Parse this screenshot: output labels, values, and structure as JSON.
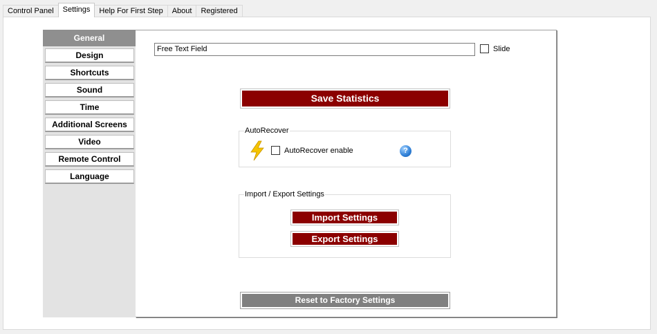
{
  "tabs": [
    "Control Panel",
    "Settings",
    "Help For First Step",
    "About",
    "Registered"
  ],
  "active_tab": "Settings",
  "nav": {
    "items": [
      "General",
      "Design",
      "Shortcuts",
      "Sound",
      "Time",
      "Additional Screens",
      "Video",
      "Remote Control",
      "Language"
    ],
    "selected": "General"
  },
  "general": {
    "free_text_value": "Free Text Field",
    "slide_label": "Slide",
    "save_statistics_label": "Save Statistics",
    "autorecover": {
      "group_title": "AutoRecover",
      "enable_label": "AutoRecover enable",
      "help_glyph": "?"
    },
    "import_export": {
      "group_title": "Import / Export Settings",
      "import_label": "Import Settings",
      "export_label": "Export Settings"
    },
    "reset_label": "Reset to Factory Settings"
  },
  "icons": {
    "autorecover": "lightning-icon",
    "help": "help-icon"
  },
  "colors": {
    "button_red": "#8b0000",
    "button_grey": "#808080",
    "nav_selected": "#8f8f8f",
    "nav_panel": "#e3e3e3"
  }
}
